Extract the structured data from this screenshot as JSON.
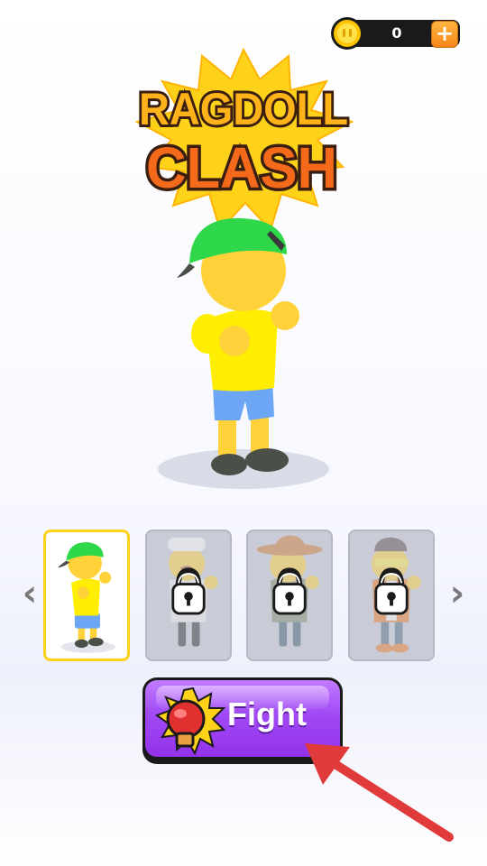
{
  "coins": {
    "count": "0",
    "add_label": "+"
  },
  "logo": {
    "line1": "RAGDOLL",
    "line2": "CLASH"
  },
  "carousel": {
    "prev_label": "‹",
    "next_label": "›",
    "cards": [
      {
        "name": "green-cap-character",
        "locked": false,
        "selected": true
      },
      {
        "name": "chef-character",
        "locked": true,
        "selected": false
      },
      {
        "name": "cowboy-character",
        "locked": true,
        "selected": false
      },
      {
        "name": "sunglasses-character",
        "locked": true,
        "selected": false
      }
    ]
  },
  "fight": {
    "label": "Fight"
  },
  "colors": {
    "accent": "#a049f4",
    "coin": "#ffd21a",
    "shirt": "#ffee00",
    "cap": "#2fd84a",
    "shorts": "#6da6f5",
    "arrow": "#e03a3a"
  },
  "icons": {
    "coin": "coin-icon",
    "plus": "plus-icon",
    "glove": "boxing-glove-icon",
    "lock": "lock-icon",
    "pointer": "pointer-arrow-icon"
  }
}
